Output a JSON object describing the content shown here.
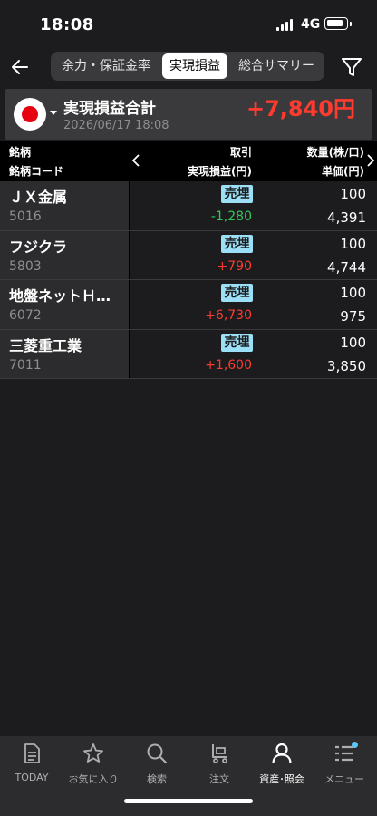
{
  "status": {
    "time": "18:08",
    "network": "4G"
  },
  "nav": {
    "tabs": [
      {
        "label": "余力・保証金率"
      },
      {
        "label": "実現損益"
      },
      {
        "label": "総合サマリー"
      }
    ],
    "active_tab": 1
  },
  "summary": {
    "title": "実現損益合計",
    "date": "2026/06/17 18:08",
    "total": "+7,840円"
  },
  "table": {
    "header": {
      "name": "銘柄",
      "code": "銘柄コード",
      "trade": "取引",
      "pl": "実現損益(円)",
      "qty": "数量(株/口)",
      "price": "単価(円)"
    },
    "rows": [
      {
        "name": "ＪＸ金属",
        "code": "5016",
        "trade": "売埋",
        "pl": "-1,280",
        "qty": "100",
        "price": "4,391"
      },
      {
        "name": "フジクラ",
        "code": "5803",
        "trade": "売埋",
        "pl": "+790",
        "qty": "100",
        "price": "4,744"
      },
      {
        "name": "地盤ネットＨ…",
        "code": "6072",
        "trade": "売埋",
        "pl": "+6,730",
        "qty": "100",
        "price": "975"
      },
      {
        "name": "三菱重工業",
        "code": "7011",
        "trade": "売埋",
        "pl": "+1,600",
        "qty": "100",
        "price": "3,850"
      }
    ]
  },
  "tabbar": {
    "items": [
      {
        "label": "TODAY",
        "icon": "today-doc-icon"
      },
      {
        "label": "お気に入り",
        "icon": "star-icon"
      },
      {
        "label": "検索",
        "icon": "search-icon"
      },
      {
        "label": "注文",
        "icon": "cart-icon"
      },
      {
        "label": "資産･照会",
        "icon": "person-icon"
      },
      {
        "label": "メニュー",
        "icon": "menu-list-icon"
      }
    ],
    "active_index": 4
  },
  "colors": {
    "background": "#1c1c1e",
    "profit": "#ff3b30",
    "loss": "#34c759",
    "trade_badge": "#9be0f7"
  }
}
